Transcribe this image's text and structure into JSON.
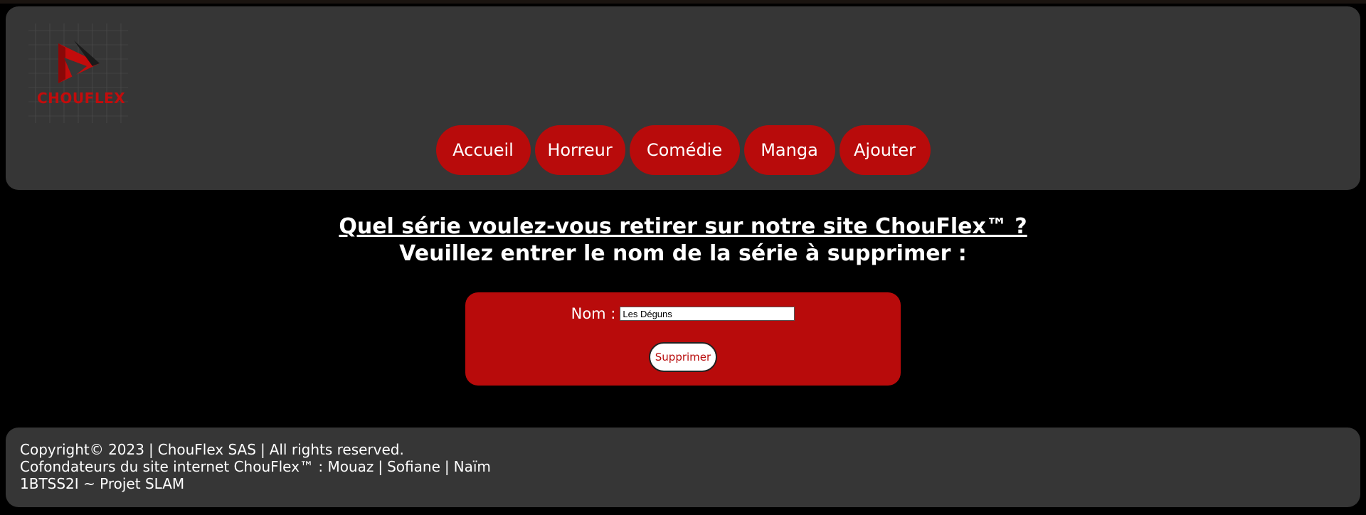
{
  "brand": {
    "logo_text": "CHOUFLEX",
    "colors": {
      "accent_red": "#b80b0b",
      "panel_gray": "#363636",
      "background": "#000000",
      "text": "#ffffff"
    }
  },
  "nav": {
    "items": [
      {
        "label": "Accueil"
      },
      {
        "label": "Horreur"
      },
      {
        "label": "Comédie"
      },
      {
        "label": "Manga"
      },
      {
        "label": "Ajouter"
      }
    ]
  },
  "main": {
    "title": "Quel série voulez-vous retirer sur notre site ChouFlex™ ?",
    "subtitle": "Veuillez entrer le nom de la série à supprimer :",
    "form": {
      "name_label": "Nom :",
      "name_value": "Les Déguns",
      "submit_label": "Supprimer"
    }
  },
  "footer": {
    "copyright": "Copyright© 2023",
    "company": "ChouFlex SAS",
    "rights": "All rights reserved.",
    "founders_prefix": "Cofondateurs du site internet ChouFlex™ :",
    "founders": [
      "Mouaz",
      "Sofiane",
      "Naïm"
    ],
    "project": "1BTSS2I ~ Projet SLAM"
  }
}
